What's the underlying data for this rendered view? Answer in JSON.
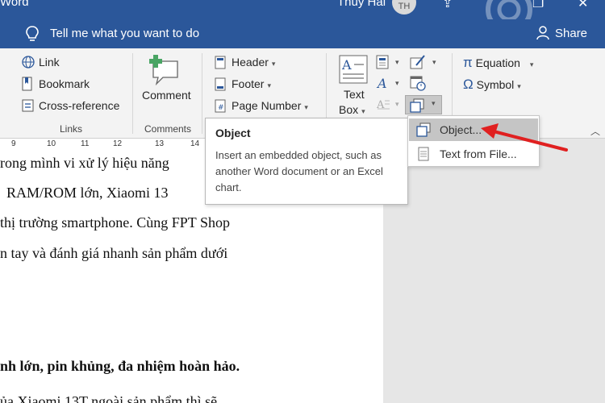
{
  "titlebar": {
    "app_name": "Word",
    "user_name": "Thuy Hai",
    "avatar_initials": "TH"
  },
  "tellbar": {
    "placeholder": "Tell me what you want to do",
    "share_label": "Share"
  },
  "ribbon": {
    "links_group": {
      "items": [
        "Link",
        "Bookmark",
        "Cross-reference"
      ],
      "label": "Links"
    },
    "comments_group": {
      "comment_label": "Comment",
      "label": "Comments"
    },
    "header_footer": {
      "items": [
        "Header",
        "Footer",
        "Page Number"
      ]
    },
    "text_group": {
      "text_box_line1": "Text",
      "text_box_line2": "Box"
    },
    "symbols_group": {
      "items": [
        "Equation",
        "Symbol"
      ]
    }
  },
  "ruler": {
    "ticks": [
      "9",
      "10",
      "11",
      "12",
      "13",
      "14"
    ]
  },
  "document": {
    "lines": [
      "rong mình vi xử lý hiệu năng",
      "RAM/ROM lớn, Xiaomi 13",
      "thị trường smartphone. Cùng FPT Shop",
      "n tay và đánh giá nhanh sản phẩm dưới",
      "nh lớn, pin khủng, đa nhiệm hoàn hảo.",
      "ủa Xiaomi 13T ngoài sản phẩm thì sẽ"
    ]
  },
  "tooltip": {
    "title": "Object",
    "body": "Insert an embedded object, such as another Word document or an Excel chart."
  },
  "object_menu": {
    "items": [
      "Object...",
      "Text from File..."
    ]
  },
  "colors": {
    "word_blue": "#2b579a",
    "arrow_red": "#e02020",
    "menu_highlight": "#c5c5c5"
  }
}
